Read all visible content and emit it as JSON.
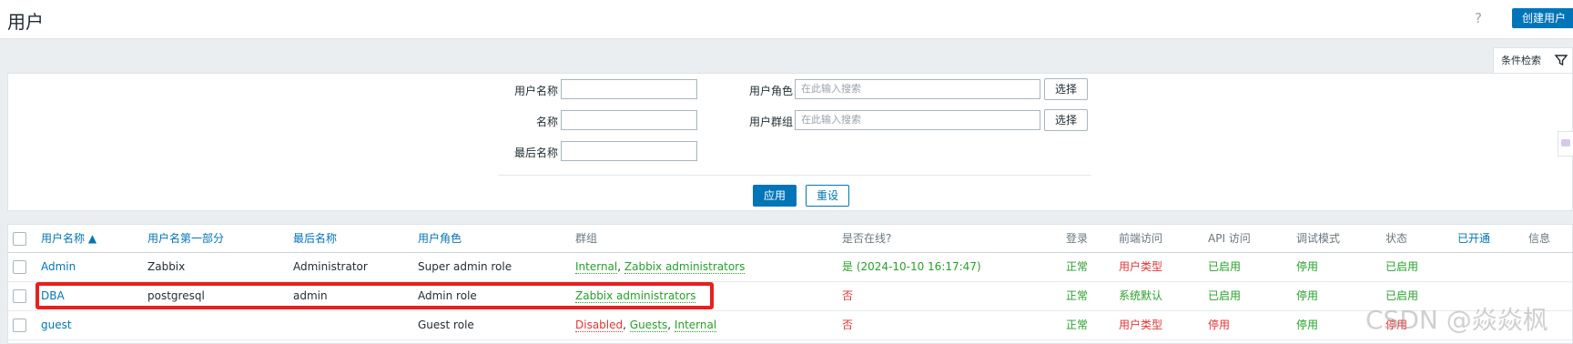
{
  "header": {
    "title": "用户",
    "help_label": "?",
    "create_label": "创建用户"
  },
  "filter": {
    "tab_label": "条件检索",
    "fields": {
      "username_label": "用户名称",
      "username_value": "",
      "name_label": "名称",
      "name_value": "",
      "lastname_label": "最后名称",
      "lastname_value": "",
      "role_label": "用户角色",
      "role_placeholder": "在此输入搜索",
      "role_select": "选择",
      "group_label": "用户群组",
      "group_placeholder": "在此输入搜索",
      "group_select": "选择"
    },
    "apply_label": "应用",
    "reset_label": "重设"
  },
  "table": {
    "headers": [
      "用户名称 ▲",
      "用户名第一部分",
      "最后名称",
      "用户角色",
      "群组",
      "是否在线?",
      "登录",
      "前端访问",
      "API 访问",
      "调试模式",
      "状态",
      "已开通",
      "信息"
    ],
    "rows": [
      {
        "username": "Admin",
        "first": "Zabbix",
        "last": "Administrator",
        "role": "Super admin role",
        "groups": [
          "Internal",
          "Zabbix administrators"
        ],
        "online": "是 (2024-10-10 16:17:47)",
        "login": "正常",
        "frontend": "用户类型",
        "api": "已启用",
        "debug": "停用",
        "status": "已启用"
      },
      {
        "username": "DBA",
        "first": "postgresql",
        "last": "admin",
        "role": "Admin role",
        "groups": [
          "Zabbix administrators"
        ],
        "online": "否",
        "login": "正常",
        "frontend": "系统默认",
        "api": "已启用",
        "debug": "停用",
        "status": "已启用"
      },
      {
        "username": "guest",
        "first": "",
        "last": "",
        "role": "Guest role",
        "groups": [
          "Disabled",
          "Guests",
          "Internal"
        ],
        "online": "否",
        "login": "正常",
        "frontend": "用户类型",
        "api": "停用",
        "debug": "停用",
        "status": "停用"
      }
    ]
  },
  "watermark": "CSDN @焱焱枫",
  "colors": {
    "accent": "#0275b8",
    "ok": "#26a12a",
    "bad": "#e33434",
    "highlight": "#e8201f"
  }
}
